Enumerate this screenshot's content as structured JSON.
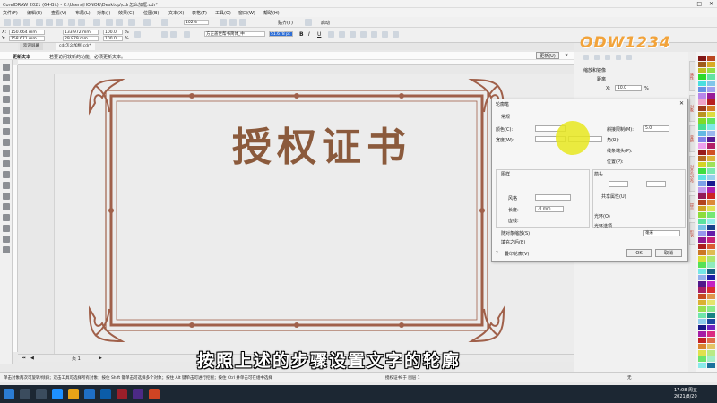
{
  "app": {
    "title": "CorelDRAW 2021 (64-Bit) - C:\\Users\\HONOR\\Desktop\\cdr怎么加框.cdr*"
  },
  "menu": [
    "文件(F)",
    "编辑(E)",
    "查看(V)",
    "布局(L)",
    "对象(J)",
    "效果(C)",
    "位图(B)",
    "文本(X)",
    "表格(T)",
    "工具(O)",
    "窗口(W)",
    "帮助(H)"
  ],
  "toolbar": {
    "zoom": "102%",
    "snap_label": "贴齐(T)",
    "launch_label": "启动"
  },
  "propbar": {
    "x": "150.664 mm",
    "y": "158.671 mm",
    "w": "133.972 mm",
    "h": "29.879 mm",
    "sx": "100.0",
    "sy": "100.0",
    "pct": "%",
    "font": "方正盖世帮书简体_中",
    "font_size": "51.678 pt"
  },
  "tabs": [
    "欢迎屏幕",
    "cdr怎么加框.cdr*"
  ],
  "hint": {
    "label": "更新文本",
    "text": "若要访问较新的功能，必须更新文本。",
    "button": "更新(U)"
  },
  "certificate": {
    "title": "授权证书"
  },
  "pagenav": {
    "page": "页 1"
  },
  "status": {
    "hint": "单击对象两次可旋转/倾斜；双击工具可选择所有对象；按住 Shift 键单击可选择多个对象；按住 Alt 键单击可进行挖掘；按住 Ctrl 并单击可在组中选择",
    "object": "授权证书 于 图层 1",
    "fill_none": "无"
  },
  "taskbar": {
    "time": "17:08 周五",
    "date": "2021/8/20"
  },
  "docker": {
    "title": "缩放和镜像",
    "distance": "距离",
    "x_value": "10.0",
    "pct": "%"
  },
  "docker_tabs": [
    "属性",
    "对象",
    "变换",
    "对齐与分布",
    "提示",
    "形状"
  ],
  "dialog": {
    "title": "轮廓笔",
    "general": "常规",
    "color": "颜色(C):",
    "width": "宽度(W):",
    "miter_limit": "斜接限制(M):",
    "miter_value": "5.0",
    "corners": "角(R):",
    "line_caps": "线条端头(P):",
    "position": "位置(P):",
    "style_group": "图样",
    "style": "风格",
    "length": "长度:",
    "length_value": ".0 mm",
    "dash": "虚线:",
    "arrows": "箭头",
    "share_props": "共享属性(U)",
    "overprint": "随对象缩放(S)",
    "fill_behind": "填充之后(B)",
    "calligraphy": "书法",
    "stretch": "光环(O)",
    "halo_options": "光环选项",
    "unit": "毫米",
    "overprint_outline": "叠印轮廓(V)",
    "ok": "OK",
    "cancel": "取消",
    "help": "?"
  },
  "subtitle": "按照上述的步骤设置文字的轮廓",
  "logo": "ODW1234",
  "colors": {
    "frame": "#a0604a",
    "title": "#8b5a3c",
    "accent": "#f2a33a"
  }
}
